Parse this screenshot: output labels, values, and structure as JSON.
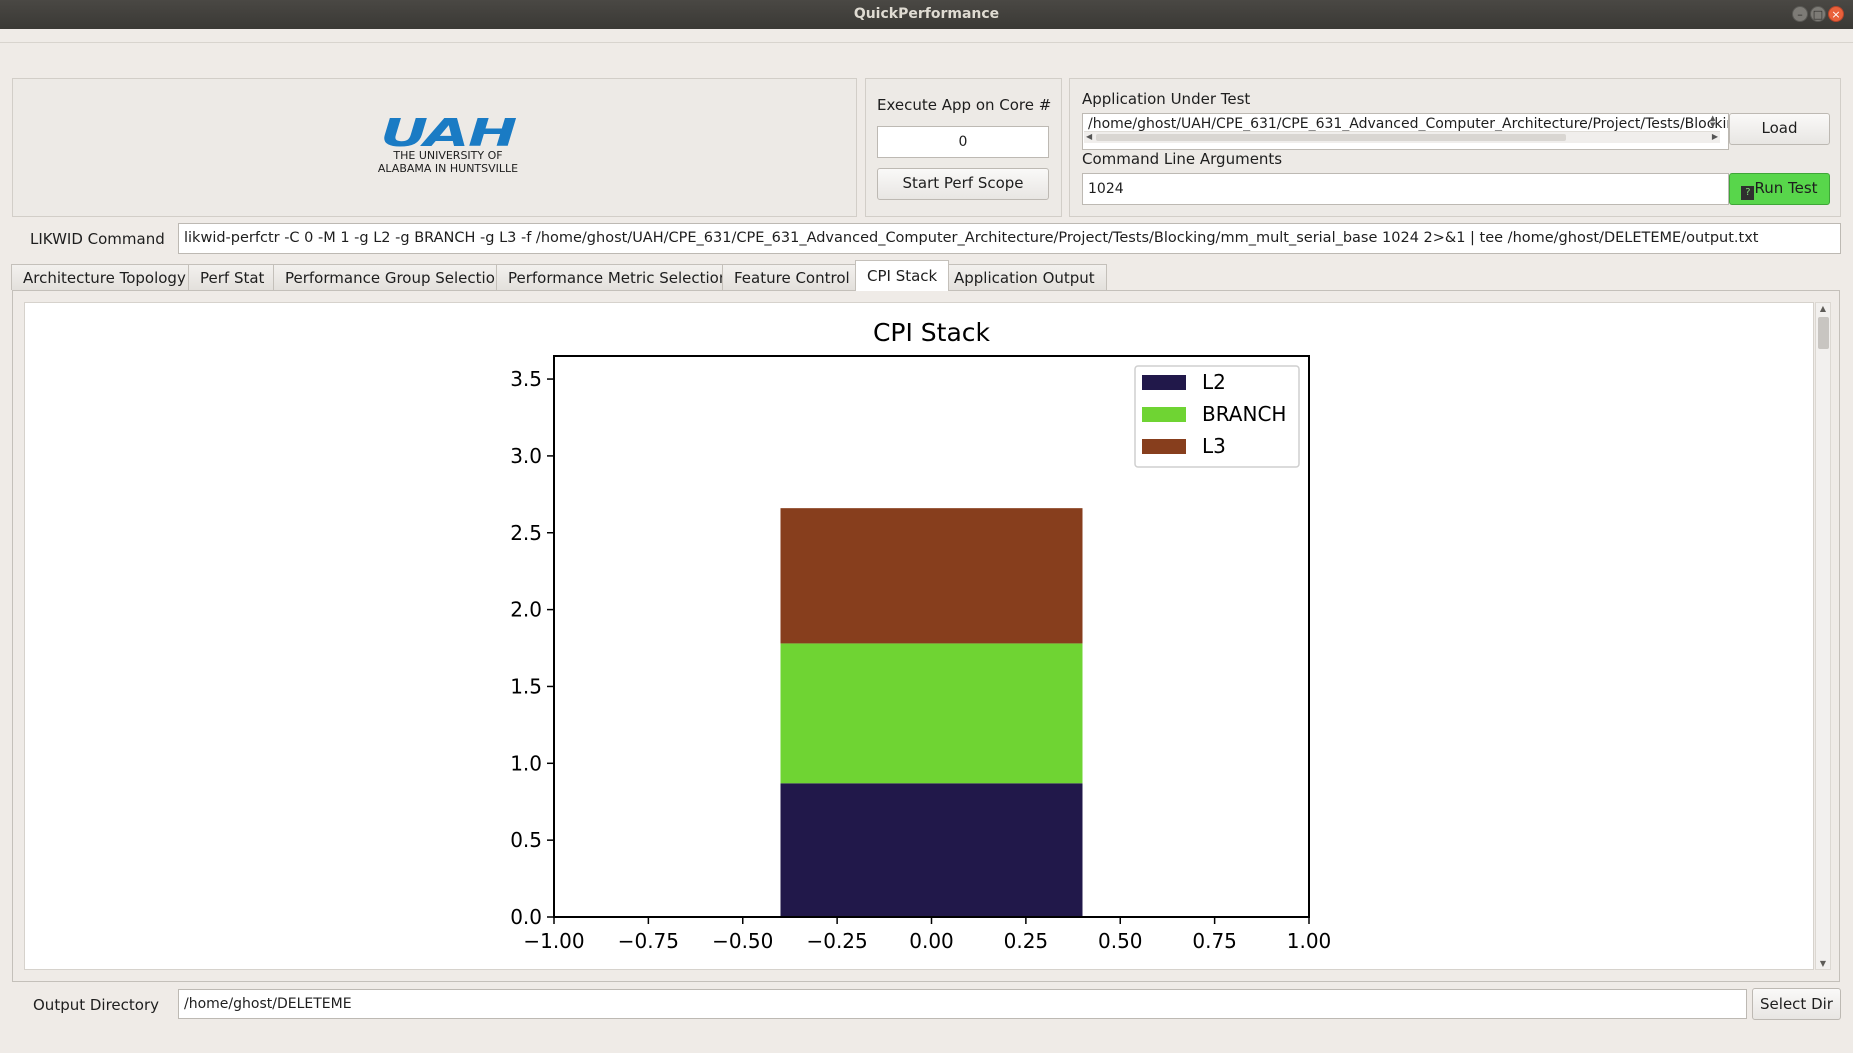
{
  "window": {
    "title": "QuickPerformance",
    "controls": {
      "minimize": "–",
      "maximize": "□",
      "close": "×"
    }
  },
  "logo": {
    "mark": "UAH",
    "line1": "THE UNIVERSITY OF",
    "line2": "ALABAMA IN HUNTSVILLE",
    "color": "#1a7bc4"
  },
  "core": {
    "label": "Execute App on Core #",
    "value": "0",
    "start_button": "Start Perf Scope"
  },
  "app": {
    "label": "Application Under Test",
    "path": "/home/ghost/UAH/CPE_631/CPE_631_Advanced_Computer_Architecture/Project/Tests/Blocking/mm_mult_serial_base",
    "load_button": "Load",
    "args_label": "Command Line Arguments",
    "args_value": "1024",
    "run_button": "Run Test",
    "run_button_color": "#58d64b"
  },
  "likwid": {
    "label": "LIKWID Command",
    "command": "likwid-perfctr -C 0 -M 1 -g L2 -g BRANCH -g L3  -f /home/ghost/UAH/CPE_631/CPE_631_Advanced_Computer_Architecture/Project/Tests/Blocking/mm_mult_serial_base 1024 2>&1 | tee /home/ghost/DELETEME/output.txt"
  },
  "tabs": [
    {
      "label": "Architecture Topology"
    },
    {
      "label": "Perf Stat"
    },
    {
      "label": "Performance Group Selection"
    },
    {
      "label": "Performance Metric Selection"
    },
    {
      "label": "Feature Control"
    },
    {
      "label": "CPI Stack",
      "active": true
    },
    {
      "label": "Application Output"
    }
  ],
  "output": {
    "label": "Output Directory",
    "value": "/home/ghost/DELETEME",
    "select_button": "Select Dir"
  },
  "chart_data": {
    "type": "bar",
    "stacked": true,
    "title": "CPI Stack",
    "xlabel": "",
    "ylabel": "",
    "x": [
      0
    ],
    "bar_width": 0.8,
    "series": [
      {
        "name": "L2",
        "values": [
          0.87
        ],
        "color": "#21184a"
      },
      {
        "name": "BRANCH",
        "values": [
          0.91
        ],
        "color": "#6fd433"
      },
      {
        "name": "L3",
        "values": [
          0.88
        ],
        "color": "#873e1d"
      }
    ],
    "xlim": [
      -1.0,
      1.0
    ],
    "ylim": [
      0.0,
      3.65
    ],
    "xticks": [
      "−1.00",
      "−0.75",
      "−0.50",
      "−0.25",
      "0.00",
      "0.25",
      "0.50",
      "0.75",
      "1.00"
    ],
    "xtick_values": [
      -1.0,
      -0.75,
      -0.5,
      -0.25,
      0.0,
      0.25,
      0.5,
      0.75,
      1.0
    ],
    "yticks": [
      "0.0",
      "0.5",
      "1.0",
      "1.5",
      "2.0",
      "2.5",
      "3.0",
      "3.5"
    ],
    "ytick_values": [
      0.0,
      0.5,
      1.0,
      1.5,
      2.0,
      2.5,
      3.0,
      3.5
    ],
    "legend_position": "top-right",
    "grid": false
  }
}
